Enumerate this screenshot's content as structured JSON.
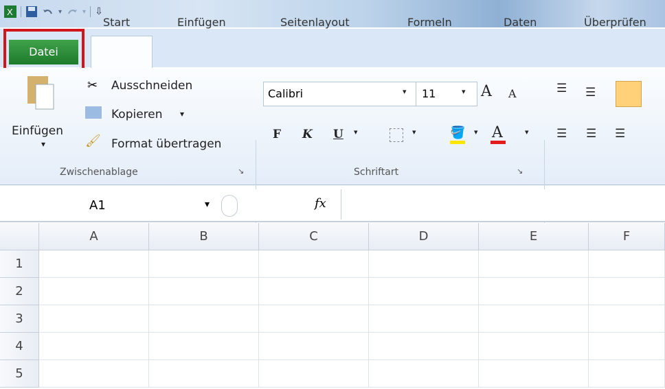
{
  "quick_access": {
    "icons": [
      "excel-icon",
      "save-icon",
      "undo-icon",
      "redo-icon",
      "customize-icon"
    ]
  },
  "tabs": {
    "datei": "Datei",
    "start": "Start",
    "einfuegen": "Einfügen",
    "seitenlayout": "Seitenlayout",
    "formeln": "Formeln",
    "daten": "Daten",
    "ueberpruefen": "Überprüfen"
  },
  "clipboard": {
    "paste": "Einfügen",
    "cut": "Ausschneiden",
    "copy": "Kopieren",
    "copy_arrow": "▾",
    "format": "Format übertragen",
    "group": "Zwischenablage"
  },
  "font": {
    "name": "Calibri",
    "size": "11",
    "bold": "F",
    "italic": "K",
    "underline": "U",
    "group": "Schriftart"
  },
  "formula_bar": {
    "name_box": "A1",
    "fx": "fx",
    "value": ""
  },
  "grid": {
    "columns": [
      "A",
      "B",
      "C",
      "D",
      "E",
      "F"
    ],
    "rows": [
      "1",
      "2",
      "3",
      "4",
      "5"
    ]
  },
  "colors": {
    "accent_red": "#d0151c",
    "file_green": "#2b8a37"
  }
}
